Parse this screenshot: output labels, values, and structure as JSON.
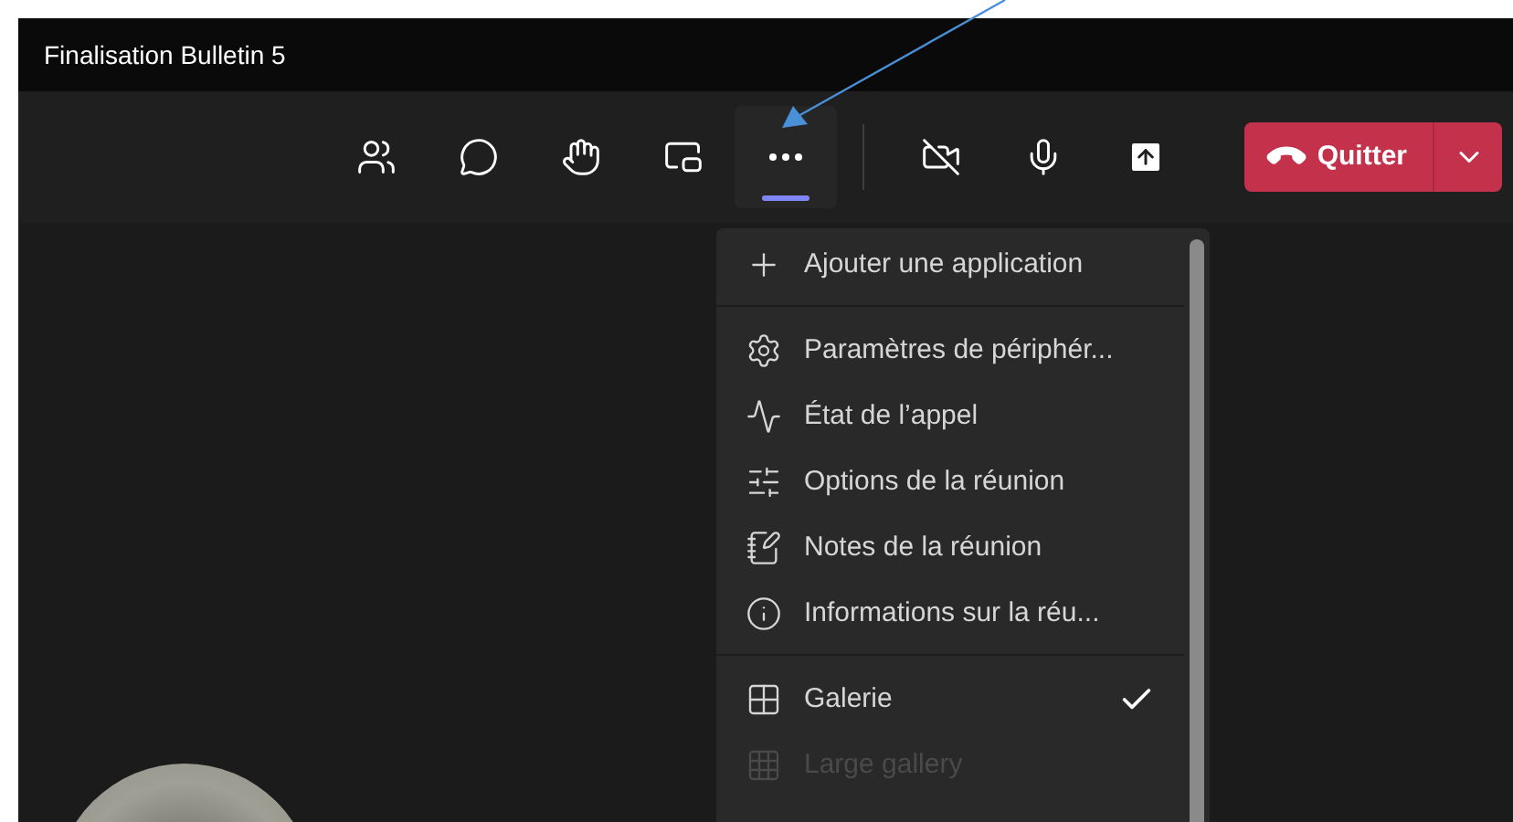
{
  "window": {
    "title": "Finalisation Bulletin 5"
  },
  "toolbar": {
    "buttons": [
      {
        "kind": "people",
        "selected": false
      },
      {
        "kind": "chat",
        "selected": false
      },
      {
        "kind": "hand",
        "selected": false
      },
      {
        "kind": "layout",
        "selected": false
      },
      {
        "kind": "more",
        "selected": true
      },
      {
        "kind": "camera-off",
        "selected": false
      },
      {
        "kind": "mic",
        "selected": false
      },
      {
        "kind": "share",
        "selected": false
      }
    ],
    "leave_button": {
      "label": "Quitter"
    }
  },
  "menu": {
    "sections": [
      [
        {
          "kind": "add",
          "label": "Ajouter une application",
          "checked": false,
          "disabled": false
        }
      ],
      [
        {
          "kind": "settings",
          "label": "Paramètres de périphér...",
          "checked": false,
          "disabled": false
        },
        {
          "kind": "pulse",
          "label": "État de l’appel",
          "checked": false,
          "disabled": false
        },
        {
          "kind": "options",
          "label": "Options de la réunion",
          "checked": false,
          "disabled": false
        },
        {
          "kind": "notes",
          "label": "Notes de la réunion",
          "checked": false,
          "disabled": false
        },
        {
          "kind": "info",
          "label": "Informations sur la réu...",
          "checked": false,
          "disabled": false
        }
      ],
      [
        {
          "kind": "gallery",
          "label": "Galerie",
          "checked": true,
          "disabled": false
        },
        {
          "kind": "large-gallery",
          "label": "Large gallery",
          "checked": false,
          "disabled": true
        }
      ]
    ]
  }
}
